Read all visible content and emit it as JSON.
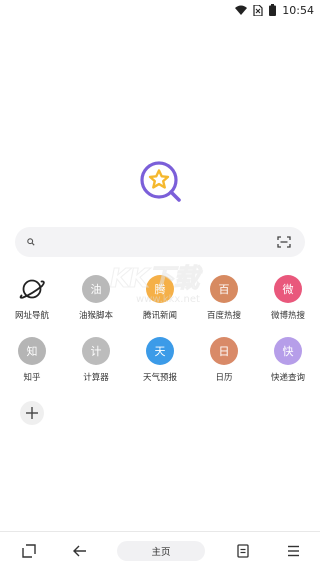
{
  "status_bar": {
    "time": "10:54"
  },
  "search": {
    "placeholder": ""
  },
  "shortcuts_row1": [
    {
      "label": "网址导航",
      "glyph": "",
      "color": "#ffffff",
      "icon": "planet-icon"
    },
    {
      "label": "油猴脚本",
      "glyph": "油",
      "color": "#b9b9b9"
    },
    {
      "label": "腾讯新闻",
      "glyph": "腾",
      "color": "#f5b048"
    },
    {
      "label": "百度热搜",
      "glyph": "百",
      "color": "#d78a61"
    },
    {
      "label": "微博热搜",
      "glyph": "微",
      "color": "#e9587c"
    }
  ],
  "shortcuts_row2": [
    {
      "label": "知乎",
      "glyph": "知",
      "color": "#b5b5b5"
    },
    {
      "label": "计算器",
      "glyph": "计",
      "color": "#bcbcbc"
    },
    {
      "label": "天气预报",
      "glyph": "天",
      "color": "#3c9be8"
    },
    {
      "label": "日历",
      "glyph": "日",
      "color": "#d98a68"
    },
    {
      "label": "快递查询",
      "glyph": "快",
      "color": "#b69ee9"
    }
  ],
  "watermark": {
    "main": "KK下载",
    "url": "www.kkx.net"
  },
  "bottom_nav": {
    "home_label": "主页"
  },
  "colors": {
    "accent_purple": "#7b5fd9",
    "accent_yellow": "#f5b82e"
  }
}
